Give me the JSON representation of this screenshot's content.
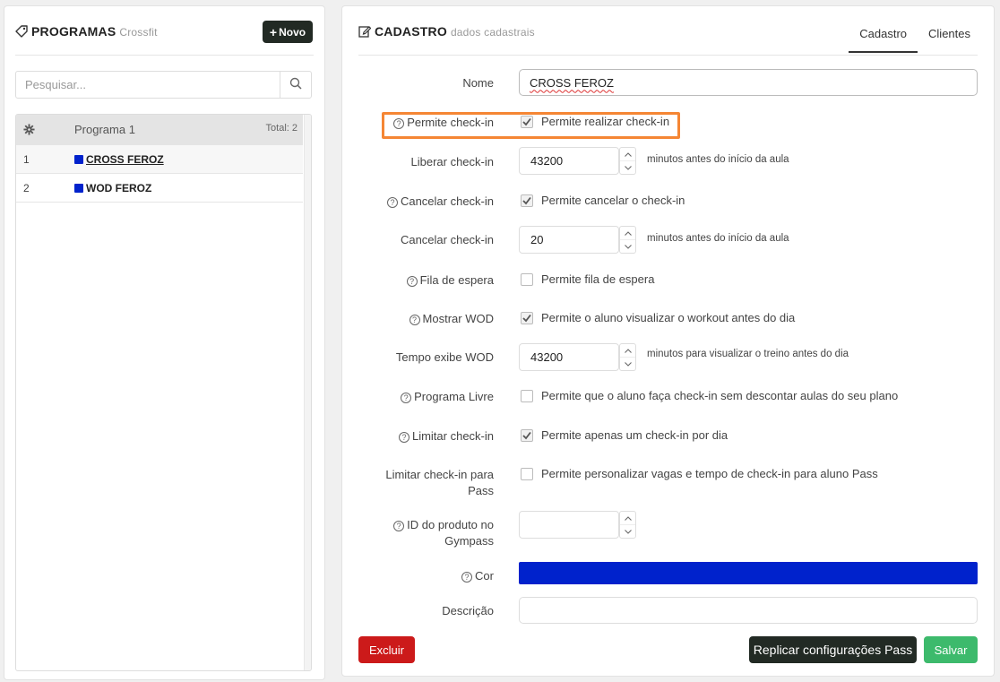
{
  "programs_panel": {
    "title": "PROGRAMAS",
    "subtitle": "Crossfit",
    "new_button": "Novo",
    "search_placeholder": "Pesquisar...",
    "list_header": "Programa 1",
    "total": "Total: 2",
    "items": [
      {
        "num": "1",
        "name": "CROSS FEROZ",
        "color": "#0022cc"
      },
      {
        "num": "2",
        "name": "WOD FEROZ",
        "color": "#0022cc"
      }
    ]
  },
  "form_panel": {
    "title": "CADASTRO",
    "subtitle": "dados cadastrais",
    "tabs": [
      "Cadastro",
      "Clientes"
    ],
    "fields": {
      "nome_label": "Nome",
      "nome_value": "CROSS FEROZ",
      "checkin_label": "Permite check-in",
      "checkin_text": "Permite realizar check-in",
      "liberar_label": "Liberar check-in",
      "liberar_value": "43200",
      "liberar_unit": "minutos antes do início da aula",
      "cancel_label": "Cancelar check-in",
      "cancel_text": "Permite cancelar o check-in",
      "cancel2_label": "Cancelar check-in",
      "cancel2_value": "20",
      "cancel2_unit": "minutos antes do início da aula",
      "fila_label": "Fila de espera",
      "fila_text": "Permite fila de espera",
      "wod_label": "Mostrar WOD",
      "wod_text": "Permite o aluno visualizar o workout antes do dia",
      "tempo_label": "Tempo exibe WOD",
      "tempo_value": "43200",
      "tempo_unit": "minutos para visualizar o treino antes do dia",
      "livre_label": "Programa Livre",
      "livre_text": "Permite que o aluno faça check-in sem descontar aulas do seu plano",
      "limitar_label": "Limitar check-in",
      "limitar_text": "Permite apenas um check-in por dia",
      "pass_label_1": "Limitar check-in para",
      "pass_label_2": "Pass",
      "pass_text": "Permite personalizar vagas e tempo de check-in para aluno Pass",
      "gympass_label_1": "ID do produto no",
      "gympass_label_2": "Gympass",
      "gympass_value": "",
      "cor_label": "Cor",
      "cor_value": "#0022cc",
      "descricao_label": "Descrição",
      "descricao_value": ""
    },
    "checkbox_states": {
      "checkin": true,
      "cancel": true,
      "fila": false,
      "wod": true,
      "livre": false,
      "limitar": true,
      "pass": false
    },
    "buttons": {
      "excluir": "Excluir",
      "replicar": "Replicar configurações Pass",
      "salvar": "Salvar"
    }
  },
  "colors": {
    "dark_button": "#222a24",
    "danger": "#cc1a1a",
    "success": "#3dba6c",
    "highlight": "#f58634",
    "program_color": "#0022cc"
  }
}
